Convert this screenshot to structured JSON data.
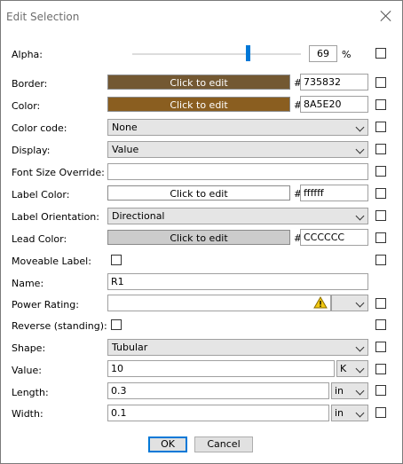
{
  "window": {
    "title": "Edit Selection"
  },
  "alpha": {
    "label": "Alpha:",
    "value": "69",
    "unit": "%",
    "level": 0.69
  },
  "border": {
    "label": "Border:",
    "button": "Click to edit",
    "hash": "#",
    "hex": "735832",
    "color": "#735832"
  },
  "color": {
    "label": "Color:",
    "button": "Click to edit",
    "hash": "#",
    "hex": "8A5E20",
    "color": "#8A5E20"
  },
  "color_code": {
    "label": "Color code:",
    "value": "None"
  },
  "display": {
    "label": "Display:",
    "value": "Value"
  },
  "font_size": {
    "label": "Font Size Override:",
    "value": ""
  },
  "label_color": {
    "label": "Label Color:",
    "button": "Click to edit",
    "hash": "#",
    "hex": "ffffff",
    "color": "#ffffff"
  },
  "label_orientation": {
    "label": "Label Orientation:",
    "value": "Directional"
  },
  "lead_color": {
    "label": "Lead Color:",
    "button": "Click to edit",
    "hash": "#",
    "hex": "CCCCCC",
    "color": "#CCCCCC"
  },
  "moveable_label": {
    "label": "Moveable Label:"
  },
  "name": {
    "label": "Name:",
    "value": "R1"
  },
  "power_rating": {
    "label": "Power Rating:",
    "value": ""
  },
  "reverse": {
    "label": "Reverse (standing):"
  },
  "shape": {
    "label": "Shape:",
    "value": "Tubular"
  },
  "value": {
    "label": "Value:",
    "value": "10",
    "unit": "K"
  },
  "length": {
    "label": "Length:",
    "value": "0.3",
    "unit": "in"
  },
  "width": {
    "label": "Width:",
    "value": "0.1",
    "unit": "in"
  },
  "buttons": {
    "ok": "OK",
    "cancel": "Cancel"
  }
}
